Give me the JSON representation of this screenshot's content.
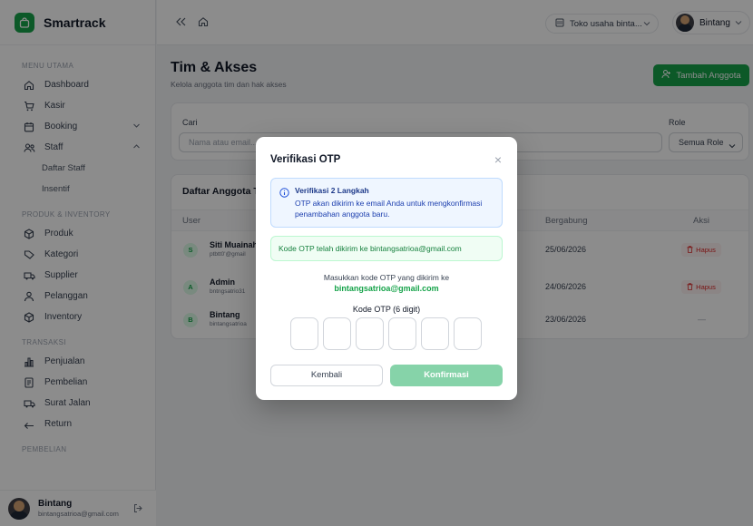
{
  "app": {
    "name": "Smartrack",
    "brand_color": "#16a34a"
  },
  "sidebar": {
    "sections": [
      {
        "title": "MENU UTAMA"
      },
      {
        "title": "PRODUK & INVENTORY"
      },
      {
        "title": "TRANSAKSI"
      },
      {
        "title": "PEMBELIAN"
      }
    ],
    "items": {
      "dashboard": "Dashboard",
      "kasir": "Kasir",
      "booking": "Booking",
      "staff": "Staff",
      "daftar_staff": "Daftar Staff",
      "insentif": "Insentif",
      "produk": "Produk",
      "kategori": "Kategori",
      "supplier": "Supplier",
      "pelanggan": "Pelanggan",
      "inventory": "Inventory",
      "penjualan": "Penjualan",
      "pembelian": "Pembelian",
      "surat_jalan": "Surat Jalan",
      "return": "Return"
    },
    "profile": {
      "name": "Bintang",
      "email": "bintangsatrioa@gmail.com"
    }
  },
  "topbar": {
    "store": "Toko usaha binta...",
    "user": "Bintang"
  },
  "page": {
    "title": "Tim & Akses",
    "subtitle": "Kelola anggota tim dan hak akses",
    "add_button": "Tambah Anggota"
  },
  "filter": {
    "search_label": "Cari",
    "search_placeholder": "Nama atau email...",
    "role_label": "Role",
    "role_value": "Semua Role"
  },
  "table": {
    "title": "Daftar Anggota T",
    "columns": {
      "user": "User",
      "joined": "Bergabung",
      "action": "Aksi"
    },
    "rows": [
      {
        "initial": "S",
        "name": "Siti Muainah",
        "email": "ptbtt0'@gmail",
        "joined": "25/06/2026",
        "action": "Hapus"
      },
      {
        "initial": "A",
        "name": "Admin",
        "email": "bntngsatrio31",
        "joined": "24/06/2026",
        "action": "Hapus"
      },
      {
        "initial": "B",
        "name": "Bintang",
        "email": "bintangsatrioa",
        "joined": "23/06/2026",
        "action": "—"
      }
    ]
  },
  "modal": {
    "title": "Verifikasi OTP",
    "info_title": "Verifikasi 2 Langkah",
    "info_text": "OTP akan dikirim ke email Anda untuk mengkonfirmasi penambahan anggota baru.",
    "success_text": "Kode OTP telah dikirim ke bintangsatrioa@gmail.com",
    "instruction": "Masukkan kode OTP yang dikirim ke",
    "email": "bintangsatrioa@gmail.com",
    "otp_label": "Kode OTP (6 digit)",
    "back_button": "Kembali",
    "confirm_button": "Konfirmasi"
  }
}
